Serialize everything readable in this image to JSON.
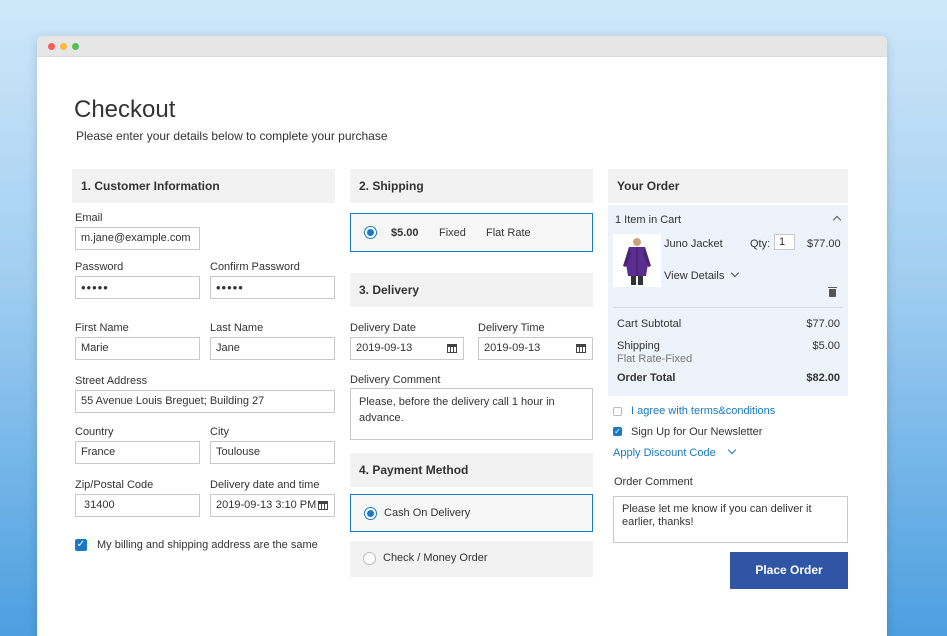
{
  "page": {
    "title": "Checkout",
    "subtitle": "Please enter your details below to complete your purchase"
  },
  "customer": {
    "heading": "1. Customer Information",
    "email_label": "Email",
    "email_value": "m.jane@example.com",
    "password_label": "Password",
    "password_value": "•••••",
    "confirm_label": "Confirm Password",
    "confirm_value": "•••••",
    "first_name_label": "First Name",
    "first_name_value": "Marie",
    "last_name_label": "Last Name",
    "last_name_value": "Jane",
    "street_label": "Street Address",
    "street_value": "55 Avenue Louis Breguet; Building 27",
    "country_label": "Country",
    "country_value": "France",
    "city_label": "City",
    "city_value": "Toulouse",
    "zip_label": "Zip/Postal Code",
    "zip_value": "31400",
    "delivery_dt_label": "Delivery date and time",
    "delivery_dt_value": "2019-09-13 3:10 PM",
    "same_address_label": "My billing and shipping address are the same",
    "same_address_checked": true
  },
  "shipping": {
    "heading": "2. Shipping",
    "price": "$5.00",
    "method": "Fixed",
    "carrier": "Flat Rate"
  },
  "delivery": {
    "heading": "3. Delivery",
    "date_label": "Delivery Date",
    "date_value": "2019-09-13",
    "time_label": "Delivery Time",
    "time_value": "2019-09-13",
    "comment_label": "Delivery Comment",
    "comment_value": "Please, before the delivery call 1 hour in advance."
  },
  "payment": {
    "heading": "4. Payment Method",
    "options": [
      {
        "label": "Cash On Delivery",
        "selected": true
      },
      {
        "label": "Check / Money Order",
        "selected": false
      }
    ]
  },
  "order": {
    "heading": "Your Order",
    "items_count": "1 Item in Cart",
    "item_name": "Juno Jacket",
    "qty_label": "Qty:",
    "qty_value": "1",
    "item_price": "$77.00",
    "view_details": "View Details",
    "subtotal_label": "Cart Subtotal",
    "subtotal_value": "$77.00",
    "shipping_label": "Shipping",
    "shipping_value": "$5.00",
    "shipping_method": "Flat Rate-Fixed",
    "total_label": "Order Total",
    "total_value": "$82.00",
    "terms_label": "I agree with terms&conditions",
    "newsletter_label": "Sign Up for Our Newsletter",
    "discount_label": "Apply Discount Code",
    "comment_label": "Order Comment",
    "comment_value": "Please let me know if you can deliver it earlier, thanks!",
    "place_order_label": "Place Order"
  },
  "colors": {
    "accent": "#1979c3",
    "button": "#2f55a4",
    "summary_bg": "#ecf3fb",
    "jacket": "#5b2d8e"
  }
}
